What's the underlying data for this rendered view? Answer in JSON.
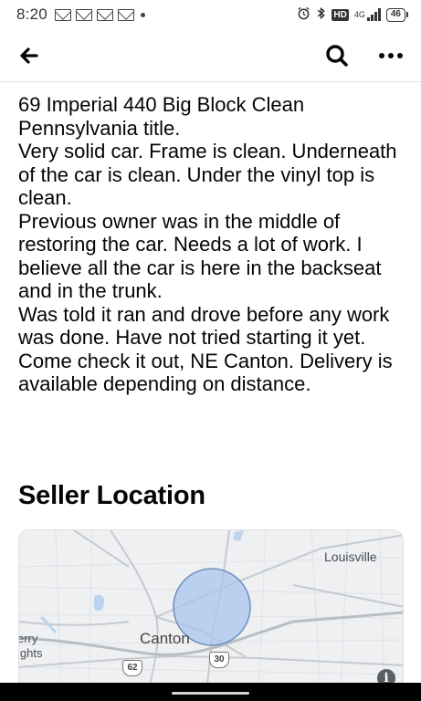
{
  "status_bar": {
    "time": "8:20",
    "network_label": "4G",
    "hd_label": "HD",
    "battery_level": "46"
  },
  "app_bar": {
    "back_icon": "arrow-left-icon",
    "search_icon": "search-icon",
    "more_icon": "more-horizontal-icon"
  },
  "description": {
    "lines": [
      "69 Imperial 440 Big Block Clean Pennsylvania title.",
      "Very solid car. Frame is clean. Underneath of the car is clean. Under the vinyl top is clean.",
      "Previous owner was in the middle of restoring the car. Needs a lot of work. I believe all the car is here in the backseat and in the trunk.",
      "Was told it ran and drove before any work was done. Have not tried starting it yet.",
      "Come check it out, NE Canton. Delivery is available depending on distance."
    ]
  },
  "seller_location": {
    "title": "Seller Location",
    "map": {
      "labels": {
        "louisville": "Louisville",
        "canton": "Canton",
        "perry": "erry",
        "heights": "ights"
      },
      "route_shields": [
        "62",
        "30"
      ],
      "info_icon": "i",
      "colors": {
        "radius_fill": "#a9c4ee",
        "radius_stroke": "#6f8fbf",
        "water": "#bcd3f0"
      }
    }
  }
}
